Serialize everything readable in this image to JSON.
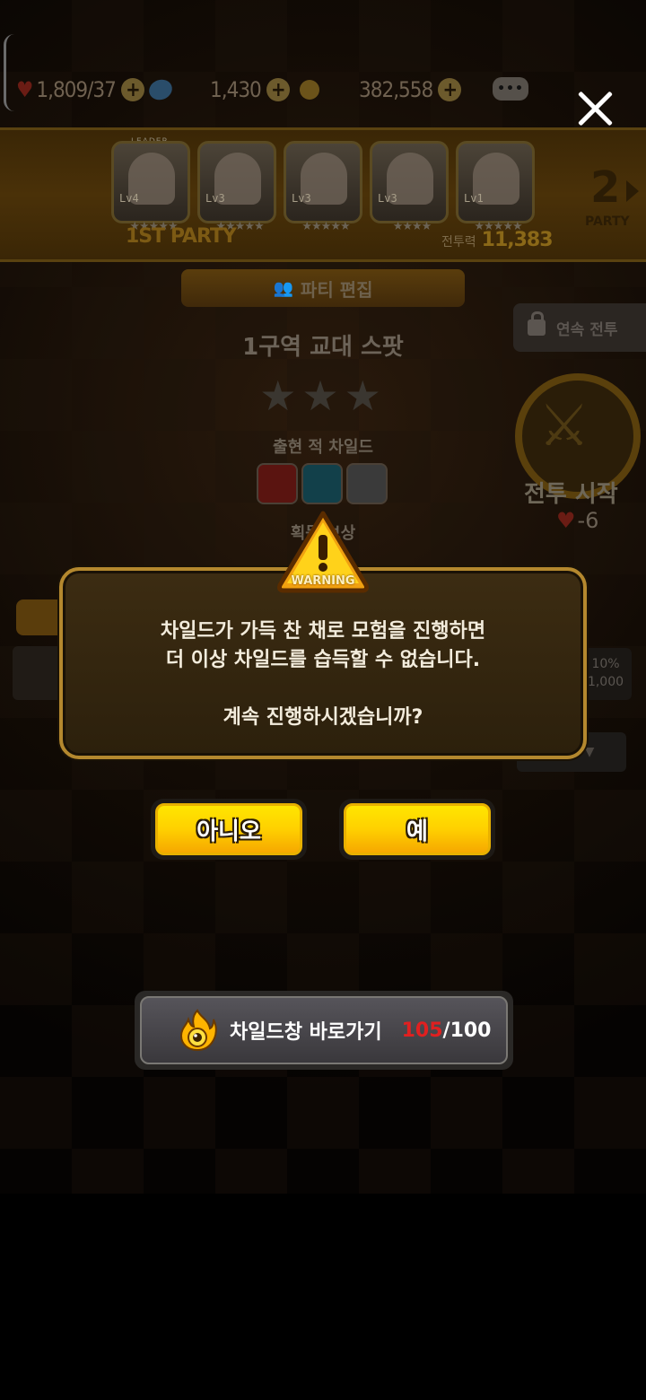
{
  "top_bar": {
    "hearts": "1,809",
    "hearts_max": "/37",
    "gems": "1,430",
    "gold": "382,558"
  },
  "party": {
    "leader_tag": "LEADER",
    "label": "1ST PARTY",
    "members": [
      {
        "level": "Lv4",
        "stars": "★★★★★"
      },
      {
        "level": "Lv3",
        "stars": "★★★★★"
      },
      {
        "level": "Lv3",
        "stars": "★★★★★"
      },
      {
        "level": "Lv3",
        "stars": "★★★★"
      },
      {
        "level": "Lv1",
        "stars": "★★★★★"
      }
    ],
    "power_label": "전투력",
    "power_value": "11,383",
    "next_party_number": "2",
    "next_party_label": "PARTY"
  },
  "stage": {
    "edit_party": "파티 편집",
    "auto_battle": "연속 전투",
    "title": "1구역 교대 스팟",
    "stars": "★★★",
    "appear_label": "출현 적 차일드",
    "reward_label": "획득 보상",
    "start_label": "전투 시작",
    "start_cost": "-6",
    "pct": "10%",
    "pct_sub": "1,000"
  },
  "dialog": {
    "warning_label": "WARNING",
    "message": "차일드가 가득 찬 채로 모험을 진행하면\n더 이상 차일드를 습득할 수 없습니다.\n\n계속 진행하시겠습니까?",
    "no_label": "아니오",
    "yes_label": "예"
  },
  "shortcut": {
    "label": "차일드창 바로가기",
    "current": "105",
    "max": "/100"
  },
  "colors": {
    "button_yellow": "#ffd000",
    "dialog_border": "#b4882e",
    "over_capacity": "#e02020"
  }
}
